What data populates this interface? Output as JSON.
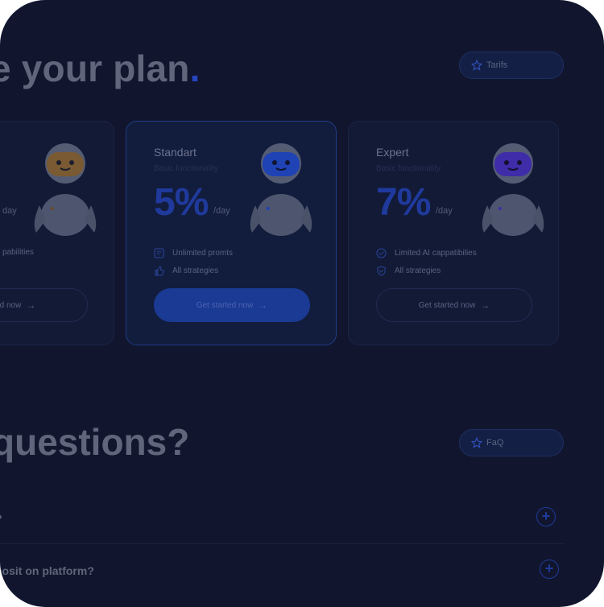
{
  "plans_section": {
    "title_text": "e your plan",
    "title_dot": ".",
    "badge_label": "Tarifs"
  },
  "plans": [
    {
      "name": "",
      "subtitle": "",
      "percent": "",
      "per": "day",
      "features": [
        "pabilities"
      ],
      "cta": "tarted now",
      "robot_face_color": "#7a5a32",
      "style": "outline"
    },
    {
      "name": "Standart",
      "subtitle": "Basic functionality",
      "percent": "5%",
      "per": "/day",
      "features": [
        "Unlimited promts",
        "All strategies"
      ],
      "cta": "Get started now",
      "robot_face_color": "#1f42b5",
      "style": "filled"
    },
    {
      "name": "Expert",
      "subtitle": "Basic functionality",
      "percent": "7%",
      "per": "/day",
      "features": [
        "Limited AI cappatibilies",
        "All strategies"
      ],
      "cta": "Get started now",
      "robot_face_color": "#3f2ca8",
      "style": "outline"
    }
  ],
  "faq_section": {
    "title_text": "questions?",
    "badge_label": "FaQ",
    "items": [
      {
        "question": "?"
      },
      {
        "question": "posit on platform?"
      }
    ]
  },
  "colors": {
    "background": "#11162e",
    "accent": "#1f3a9c",
    "text_muted": "#5f667b"
  }
}
